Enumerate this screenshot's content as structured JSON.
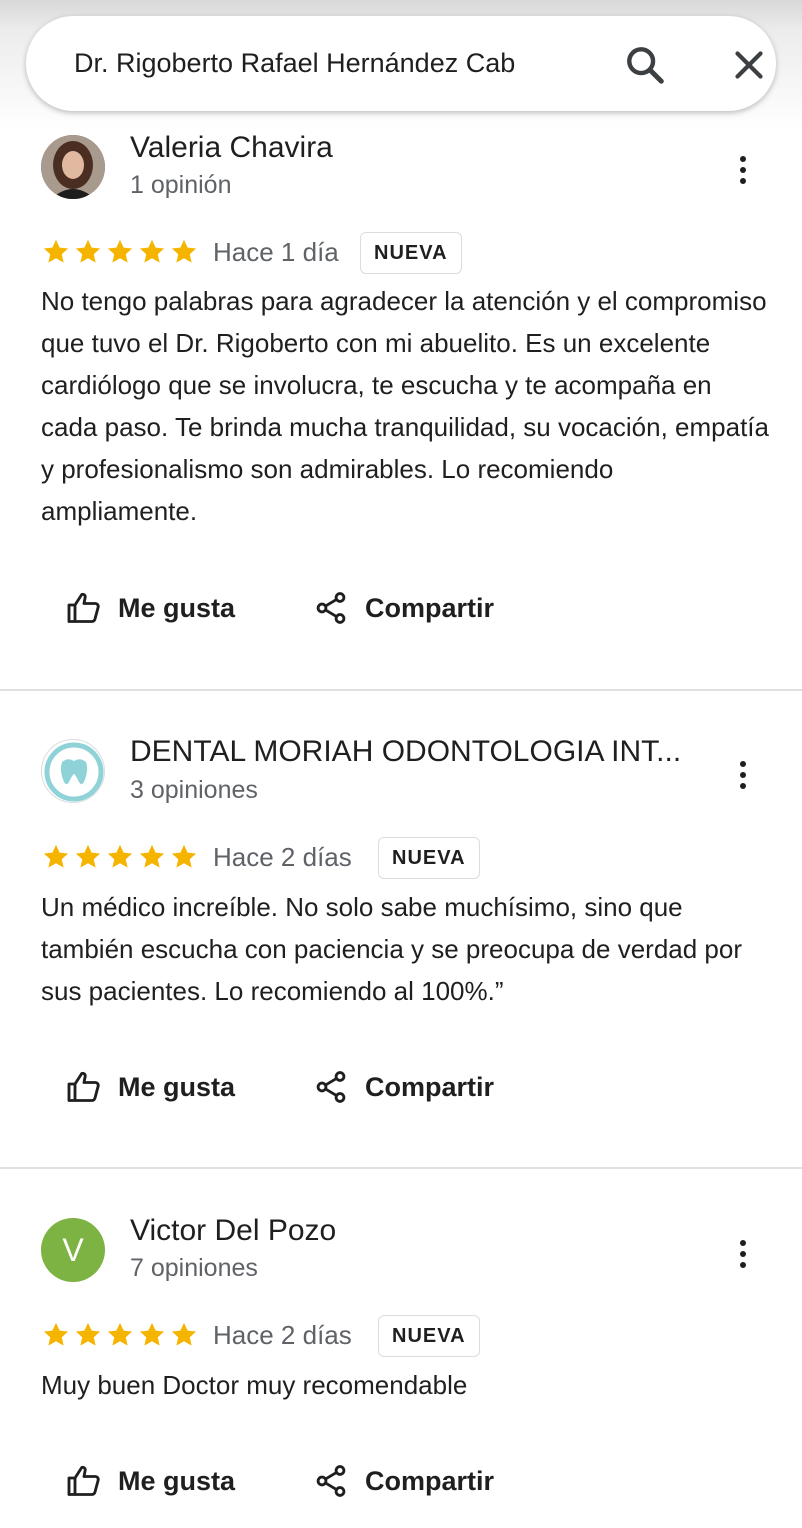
{
  "search": {
    "query": "Dr. Rigoberto Rafael Hernández Cab",
    "search_icon": "search-icon",
    "close_icon": "close-icon"
  },
  "reviews": [
    {
      "author": "Valeria Chavira",
      "meta": "1 opinión",
      "rating": 5,
      "time": "Hace 1 día",
      "badge": "NUEVA",
      "text": "No tengo palabras para agradecer la atención y el compromiso que tuvo el Dr. Rigoberto con mi abuelito. Es un excelente cardiólogo que se involucra, te escucha y te acompaña en cada paso. Te brinda mucha tranquilidad, su vocación, empatía y profesionalismo son admirables. Lo recomiendo ampliamente.",
      "like_label": "Me gusta",
      "share_label": "Compartir"
    },
    {
      "author": "DENTAL MORIAH ODONTOLOGIA INT...",
      "meta": "3 opiniones",
      "rating": 5,
      "time": "Hace 2 días",
      "badge": "NUEVA",
      "text": "Un médico increíble. No solo sabe muchísimo, sino que también escucha con paciencia y se preocupa de verdad por sus pacientes. Lo recomiendo al 100%.”",
      "like_label": "Me gusta",
      "share_label": "Compartir"
    },
    {
      "author": "Victor Del Pozo",
      "meta": "7 opiniones",
      "avatar_letter": "V",
      "rating": 5,
      "time": "Hace 2 días",
      "badge": "NUEVA",
      "text": "Muy buen Doctor muy recomendable",
      "like_label": "Me gusta",
      "share_label": "Compartir"
    }
  ],
  "colors": {
    "star": "#f4b400",
    "avatar_green": "#7cb342",
    "muted_text": "#5f6368",
    "divider": "#e0e0e0"
  }
}
